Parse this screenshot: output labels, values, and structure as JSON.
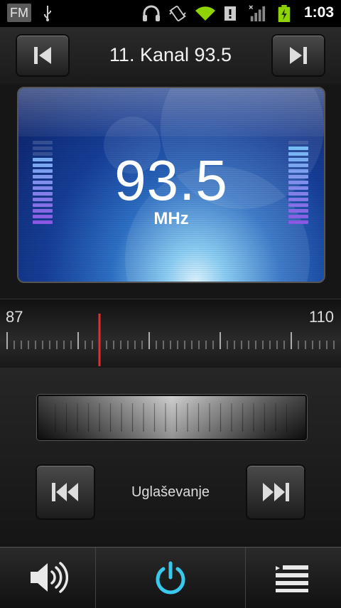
{
  "status_bar": {
    "app_badge": "FM",
    "icons": [
      "usb-icon",
      "headphones-icon",
      "vibrate-icon",
      "wifi-icon",
      "alert-icon",
      "signal-icon",
      "battery-charging-icon"
    ],
    "time": "1:03",
    "accent_color": "#8fd400"
  },
  "header": {
    "station_title": "11. Kanal 93.5",
    "prev_icon": "skip-previous-icon",
    "next_icon": "skip-next-icon"
  },
  "display": {
    "frequency": "93.5",
    "unit": "MHz",
    "vu_level_left": 0.8,
    "vu_level_right": 0.9
  },
  "dial": {
    "min_label": "87",
    "max_label": "110",
    "min_value": 87,
    "max_value": 110,
    "current_value": 93.5,
    "needle_color": "#e03030"
  },
  "tuning": {
    "label": "Uglaševanje",
    "seek_back_icon": "rewind-icon",
    "seek_forward_icon": "fast-forward-icon"
  },
  "bottom_bar": {
    "volume_icon": "speaker-volume-icon",
    "power_icon": "power-icon",
    "list_icon": "list-icon",
    "power_color": "#39c8ee"
  }
}
